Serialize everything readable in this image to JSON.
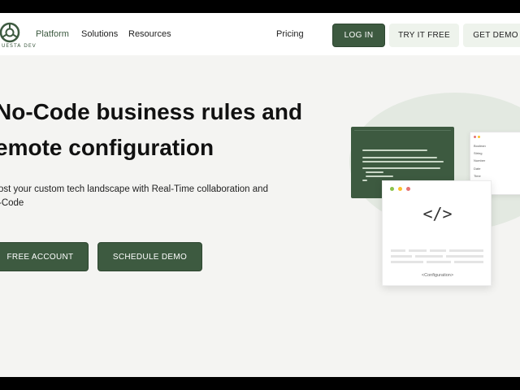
{
  "header": {
    "logo_text": "UESTA DEV",
    "nav": [
      "Platform",
      "Solutions",
      "Resources",
      "Pricing"
    ],
    "login": "LOG IN",
    "try_free": "TRY IT FREE",
    "get_demo": "GET DEMO"
  },
  "hero": {
    "title_line1": "No-Code business rules and",
    "title_line2": "emote configuration",
    "sub_line1": "ost your custom tech landscape with Real-Time collaboration and",
    "sub_line2": "-Code",
    "free_account": "FREE ACCOUNT",
    "schedule_demo": "SCHEDULE DEMO"
  },
  "illustration": {
    "code_symbol": "</>",
    "card_label": "<Configuration>",
    "list_items": [
      "Boolean",
      "String",
      "Number",
      "Date",
      "Time"
    ]
  },
  "colors": {
    "brand_green": "#3d5a40",
    "light_green": "#eef3ec",
    "background": "#f4f4f2"
  }
}
